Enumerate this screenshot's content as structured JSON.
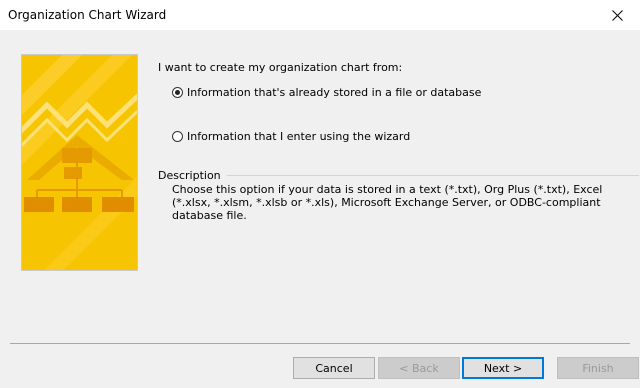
{
  "window": {
    "title": "Organization Chart Wizard",
    "close_icon": "close-icon"
  },
  "main": {
    "prompt": "I want to create my organization chart from:",
    "options": [
      {
        "label": "Information that's already stored in a file or database",
        "selected": true
      },
      {
        "label": "Information that I enter using the wizard",
        "selected": false
      }
    ],
    "description_heading": "Description",
    "description_text": "Choose this option if your data is stored in a text (*.txt), Org Plus (*.txt), Excel (*.xlsx, *.xlsm, *.xlsb or *.xls), Microsoft Exchange Server, or ODBC-compliant database file."
  },
  "buttons": {
    "cancel": "Cancel",
    "back": "< Back",
    "next": "Next >",
    "finish": "Finish"
  },
  "colors": {
    "banner_yellow": "#f7c600",
    "banner_light": "#ffd84a",
    "accent_blue": "#0078d7"
  }
}
